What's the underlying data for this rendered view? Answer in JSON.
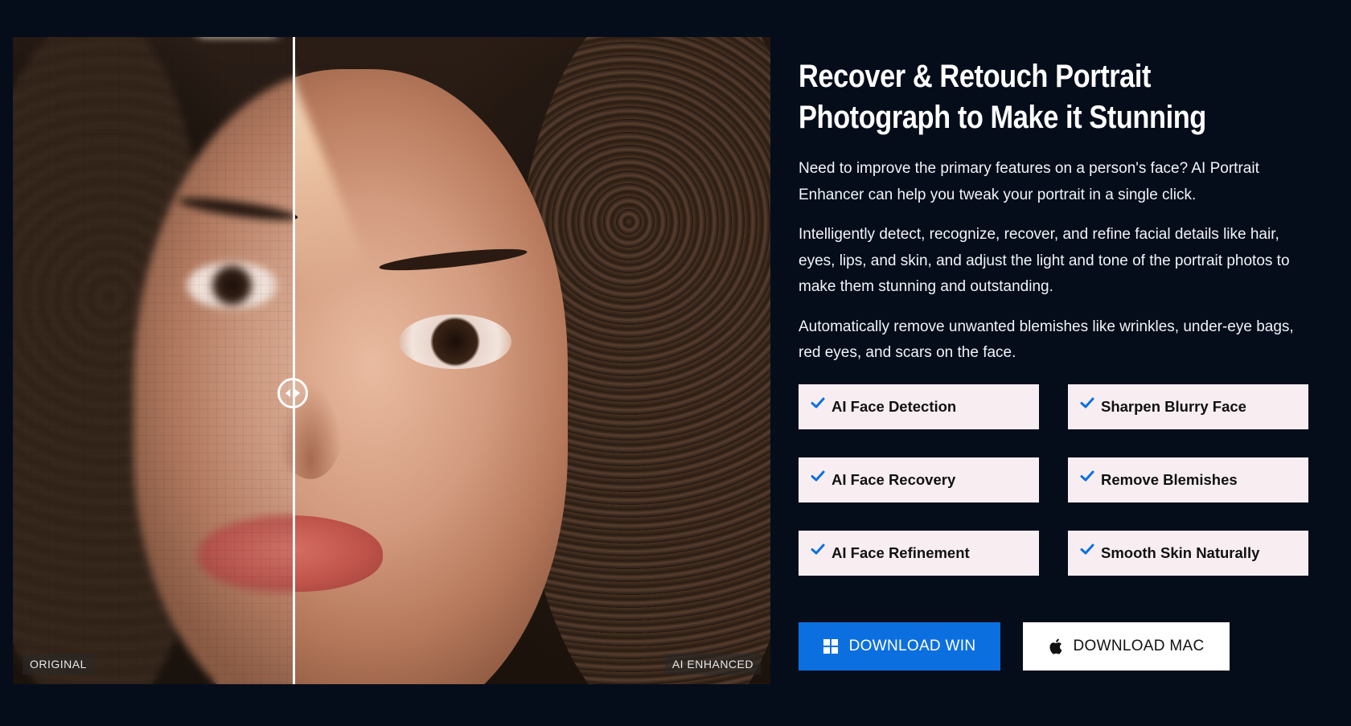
{
  "compare": {
    "label_before": "ORIGINAL",
    "label_after": "AI ENHANCED"
  },
  "hero": {
    "title_line1": "Recover & Retouch Portrait",
    "title_line2": "Photograph to Make it Stunning",
    "paragraphs": [
      "Need to improve the primary features on a person's face? AI Portrait Enhancer can help you tweak your portrait in a single click.",
      "Intelligently detect, recognize, recover, and refine facial details like hair, eyes, lips, and skin, and adjust the light and tone of the portrait photos to make them stunning and outstanding.",
      "Automatically remove unwanted blemishes like wrinkles, under-eye bags, red eyes, and scars on the face."
    ]
  },
  "features": [
    {
      "label": "AI Face Detection",
      "icon": "check-icon"
    },
    {
      "label": "Sharpen Blurry Face",
      "icon": "check-icon"
    },
    {
      "label": "AI Face Recovery",
      "icon": "check-icon"
    },
    {
      "label": "Remove Blemishes",
      "icon": "check-icon"
    },
    {
      "label": "AI Face Refinement",
      "icon": "check-icon"
    },
    {
      "label": "Smooth Skin Naturally",
      "icon": "check-icon"
    }
  ],
  "buttons": {
    "win_label": "DOWNLOAD WIN",
    "win_icon": "windows-icon",
    "mac_label": "DOWNLOAD MAC",
    "mac_icon": "apple-icon"
  },
  "colors": {
    "background": "#050d1a",
    "feature_bg": "#f8eef2",
    "check": "#0c6fe0",
    "win_button": "#0c6fe0",
    "mac_button": "#ffffff"
  }
}
